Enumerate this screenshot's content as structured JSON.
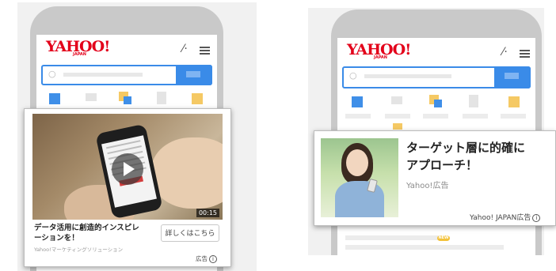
{
  "left": {
    "header": {
      "logo": "YAHOO!",
      "logo_sub": "JAPAN",
      "wand_icon": "magic-wand-icon",
      "menu_icon": "hamburger-menu-icon"
    },
    "ad": {
      "video_duration": "00:15",
      "headline": "データ活用に創造的インスピレーションを！",
      "headline_line1": "データ活用に創造的インスピレ",
      "headline_line2": "ーションを！",
      "advertiser": "Yahoo!マーケティングソリューション",
      "cta_label": "詳しくはこちら",
      "ad_label": "広告",
      "info_icon": "ⓘ"
    }
  },
  "right": {
    "header": {
      "logo": "YAHOO!",
      "logo_sub": "JAPAN",
      "wand_icon": "magic-wand-icon",
      "menu_icon": "hamburger-menu-icon"
    },
    "ad": {
      "headline_line1": "ターゲット層に的確に",
      "headline_line2": "アプローチ！",
      "sponsor": "Yahoo!広告",
      "ad_label": "Yahoo! JAPAN広告",
      "info_icon": "ⓘ"
    },
    "new_badge": "NEW"
  },
  "colors": {
    "yahoo_red": "#e3001a",
    "search_blue": "#3a8be8",
    "tile_blue": "#3f8fe8",
    "tile_yellow": "#f5c964"
  }
}
